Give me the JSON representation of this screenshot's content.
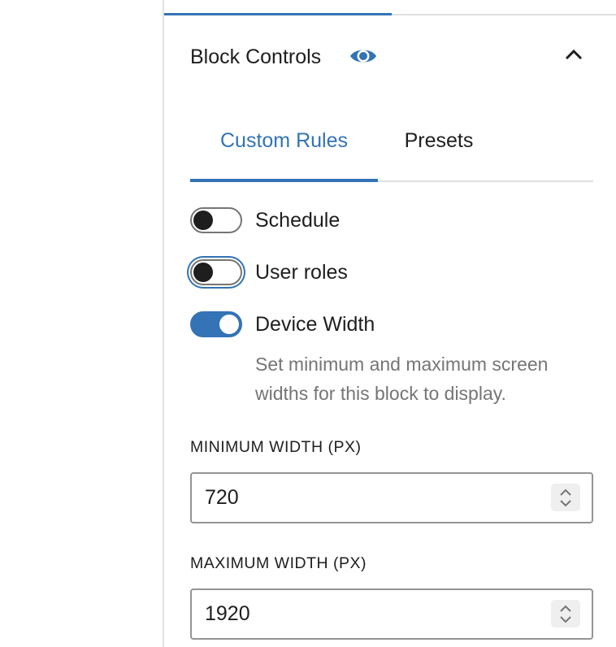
{
  "panel": {
    "title": "Block Controls",
    "icons": {
      "visibility": "eye-icon",
      "collapse": "chevron-up-icon"
    }
  },
  "tabs": [
    {
      "label": "Custom Rules",
      "active": true
    },
    {
      "label": "Presets",
      "active": false
    }
  ],
  "rules": [
    {
      "label": "Schedule",
      "enabled": false
    },
    {
      "label": "User roles",
      "enabled": false,
      "focused": true
    },
    {
      "label": "Device Width",
      "enabled": true
    }
  ],
  "device_width": {
    "help": "Set minimum and maximum screen widths for this block to display.",
    "min_label": "MINIMUM WIDTH (PX)",
    "min_value": "720",
    "max_label": "MAXIMUM WIDTH (PX)",
    "max_value": "1920"
  },
  "colors": {
    "accent": "#3373b6",
    "text": "#1e1e1e",
    "muted": "#757575",
    "border": "#e0e0e0"
  }
}
